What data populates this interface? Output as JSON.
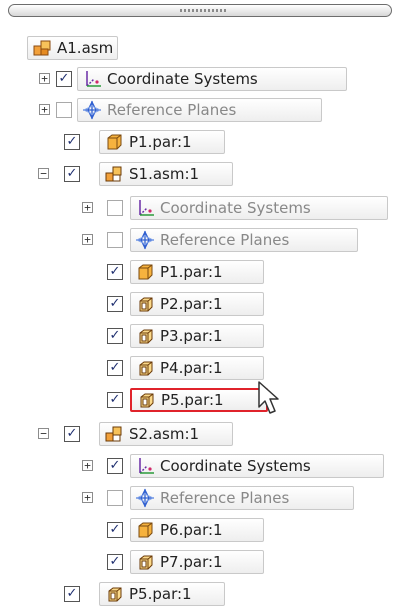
{
  "tree": {
    "root": {
      "label": "A1.asm",
      "icon": "assembly-icon"
    },
    "items": [
      {
        "label": "Coordinate Systems",
        "checked": true,
        "expander": "+",
        "icon": "coordinate-system-icon"
      },
      {
        "label": "Reference Planes",
        "checked": false,
        "expander": "+",
        "icon": "reference-plane-icon"
      },
      {
        "label": "P1.par:1",
        "checked": true,
        "expander": "",
        "icon": "part-solid-icon"
      },
      {
        "label": "S1.asm:1",
        "checked": true,
        "expander": "−",
        "icon": "subassembly-icon"
      },
      {
        "label": "Coordinate Systems",
        "checked": false,
        "expander": "+",
        "icon": "coordinate-system-icon"
      },
      {
        "label": "Reference Planes",
        "checked": false,
        "expander": "+",
        "icon": "reference-plane-icon"
      },
      {
        "label": "P1.par:1",
        "checked": true,
        "expander": "",
        "icon": "part-solid-icon"
      },
      {
        "label": "P2.par:1",
        "checked": true,
        "expander": "",
        "icon": "part-open-icon"
      },
      {
        "label": "P3.par:1",
        "checked": true,
        "expander": "",
        "icon": "part-open-icon"
      },
      {
        "label": "P4.par:1",
        "checked": true,
        "expander": "",
        "icon": "part-open-icon"
      },
      {
        "label": "P5.par:1",
        "checked": true,
        "expander": "",
        "icon": "part-open-icon",
        "selected": true
      },
      {
        "label": "S2.asm:1",
        "checked": true,
        "expander": "−",
        "icon": "subassembly-icon"
      },
      {
        "label": "Coordinate Systems",
        "checked": true,
        "expander": "+",
        "icon": "coordinate-system-icon"
      },
      {
        "label": "Reference Planes",
        "checked": false,
        "expander": "+",
        "icon": "reference-plane-icon"
      },
      {
        "label": "P6.par:1",
        "checked": true,
        "expander": "",
        "icon": "part-solid-icon"
      },
      {
        "label": "P7.par:1",
        "checked": true,
        "expander": "",
        "icon": "part-open-icon"
      },
      {
        "label": "P5.par:1",
        "checked": true,
        "expander": "",
        "icon": "part-open-icon"
      }
    ],
    "check_mark": "✓",
    "cursor": "pointer-arrow-icon"
  }
}
